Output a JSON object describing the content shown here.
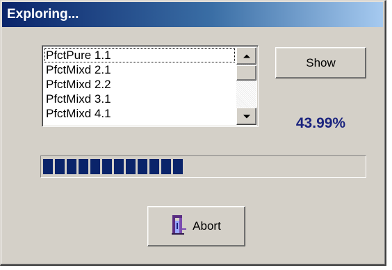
{
  "window": {
    "title": "Exploring..."
  },
  "list": {
    "items": [
      "PfctPure 1.1",
      "PfctMixd 2.1",
      "PfctMixd 2.2",
      "PfctMixd 3.1",
      "PfctMixd 4.1"
    ],
    "focused_index": 0
  },
  "buttons": {
    "show_label": "Show",
    "abort_label": "Abort"
  },
  "progress": {
    "percent_text": "43.99%",
    "value_percent": 43.99
  },
  "colors": {
    "progress_fill": "#0a246a",
    "percent_text": "#1a237e",
    "title_gradient_start": "#0a246a"
  },
  "icons": {
    "scroll_up": "up-arrow-icon",
    "scroll_down": "down-arrow-icon",
    "abort": "door-exit-icon"
  }
}
